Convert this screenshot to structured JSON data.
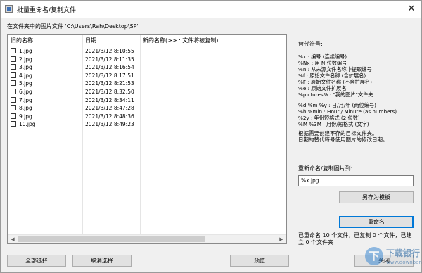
{
  "window": {
    "title": "批量重命名/复制文件",
    "close_glyph": "✕"
  },
  "path_label": "在文件夹中的图片文件 'C:\\Users\\Rah\\Desktop\\SP'",
  "list": {
    "headers": [
      "旧的名称",
      "日期",
      "新的名称(>> : 文件将被复制)"
    ],
    "rows": [
      {
        "name": "1.jpg",
        "date": "2021/3/12 8:10:55"
      },
      {
        "name": "2.jpg",
        "date": "2021/3/12 8:11:35"
      },
      {
        "name": "3.jpg",
        "date": "2021/3/12 8:16:54"
      },
      {
        "name": "4.jpg",
        "date": "2021/3/12 8:17:51"
      },
      {
        "name": "5.jpg",
        "date": "2021/3/12 8:21:53"
      },
      {
        "name": "6.jpg",
        "date": "2021/3/12 8:32:50"
      },
      {
        "name": "7.jpg",
        "date": "2021/3/12 8:34:11"
      },
      {
        "name": "8.jpg",
        "date": "2021/3/12 8:47:28"
      },
      {
        "name": "9.jpg",
        "date": "2021/3/12 8:48:36"
      },
      {
        "name": "10.jpg",
        "date": "2021/3/12 8:49:23"
      }
    ]
  },
  "buttons": {
    "select_all": "全部选择",
    "deselect": "取消选择",
    "preview": "预览",
    "save_template": "另存为模板",
    "rename": "重命名",
    "close": "关闭"
  },
  "replacements": {
    "title": "替代符号:",
    "lines": [
      "%x : 编号 (连续编号)",
      "%Nx : 用 N 位数编号",
      "%n : 从未源文件名称中提取编号",
      "%f : 原始文件名称 (含扩展名)",
      "%F : 原始文件名称 (不含扩展名)",
      "%e : 原始文件扩展名",
      "%pictures% : \"我的图片\"文件夹"
    ],
    "date_lines": [
      "%d %m %y : 日/月/年 (两位编号)",
      "%h %min : Hour / Minute (as numbers)",
      "%2y : 年份短格式 (2 位数)",
      "%M %3M : 月份/短格式 (文字)"
    ],
    "info_lines": [
      "根据需要创建不存的目标文件夹。",
      "日期的替代符号使用图片的修改日期。"
    ]
  },
  "rename": {
    "label": "重新命名/复制图片到:",
    "value": "%x.jpg"
  },
  "status": "已重命名 10 个文件，已复制 0 个文件，已建立 0 个文件夹",
  "watermark": {
    "logo_glyph": "下",
    "text": "下载银行",
    "url": "www.downbank.cn"
  }
}
